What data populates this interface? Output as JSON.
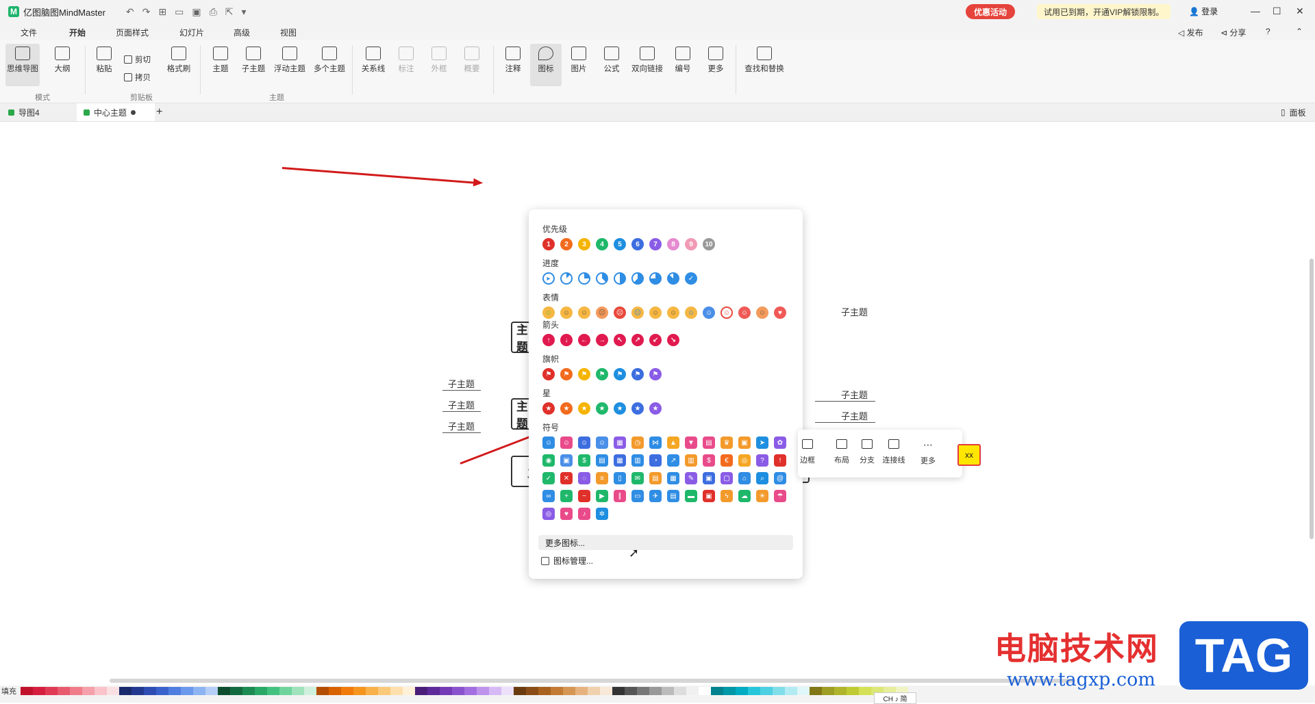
{
  "titlebar": {
    "title": "亿图脑图MindMaster",
    "promo": "优惠活动",
    "vip_notice": "试用已到期，开通VIP解锁限制。",
    "login": "登录",
    "minimize": "—",
    "maximize": "☐",
    "close": "✕"
  },
  "menu": {
    "tabs": [
      "文件",
      "开始",
      "页面样式",
      "幻灯片",
      "高级",
      "视图"
    ],
    "active": "开始",
    "publish": "发布",
    "share": "分享",
    "help": "?"
  },
  "ribbon": {
    "mind_map": "思维导图",
    "outline": "大纲",
    "group_mode": "模式",
    "paste": "粘贴",
    "cut": "剪切",
    "copy": "拷贝",
    "format_painter": "格式刷",
    "group_clipboard": "剪贴板",
    "topic": "主题",
    "subtopic": "子主题",
    "floating_topic": "浮动主题",
    "multi_topic": "多个主题",
    "group_topic": "主题",
    "relation": "关系线",
    "callout": "标注",
    "boundary": "外框",
    "summary": "概要",
    "note": "注释",
    "icon": "图标",
    "image": "图片",
    "formula": "公式",
    "bilink": "双向链接",
    "numbering": "编号",
    "more": "更多",
    "find_replace": "查找和替换"
  },
  "doctabs": {
    "tab1": "导图4",
    "tab2": "中心主题",
    "add": "+",
    "panel": "面板"
  },
  "icon_popup": {
    "sections": {
      "priority": "优先级",
      "progress": "进度",
      "emoji": "表情",
      "arrow": "箭头",
      "flag": "旗帜",
      "star": "星",
      "symbol": "符号"
    },
    "priority_labels": [
      "1",
      "2",
      "3",
      "4",
      "5",
      "6",
      "7",
      "8",
      "9",
      "10"
    ],
    "more_icons": "更多图标...",
    "icon_manage": "图标管理..."
  },
  "float_toolbar": {
    "border": "边框",
    "layout": "布局",
    "branch": "分支",
    "connector": "连接线",
    "more": "更多"
  },
  "canvas": {
    "main_topic": "主题",
    "subtopic": "子主题",
    "yellow_node": "xx"
  },
  "colorbar": {
    "fill_label": "填充"
  },
  "ime": "CH ♪ 简",
  "watermark": {
    "text": "电脑技术网",
    "url": "www.tagxp.com",
    "badge": "TAG"
  }
}
